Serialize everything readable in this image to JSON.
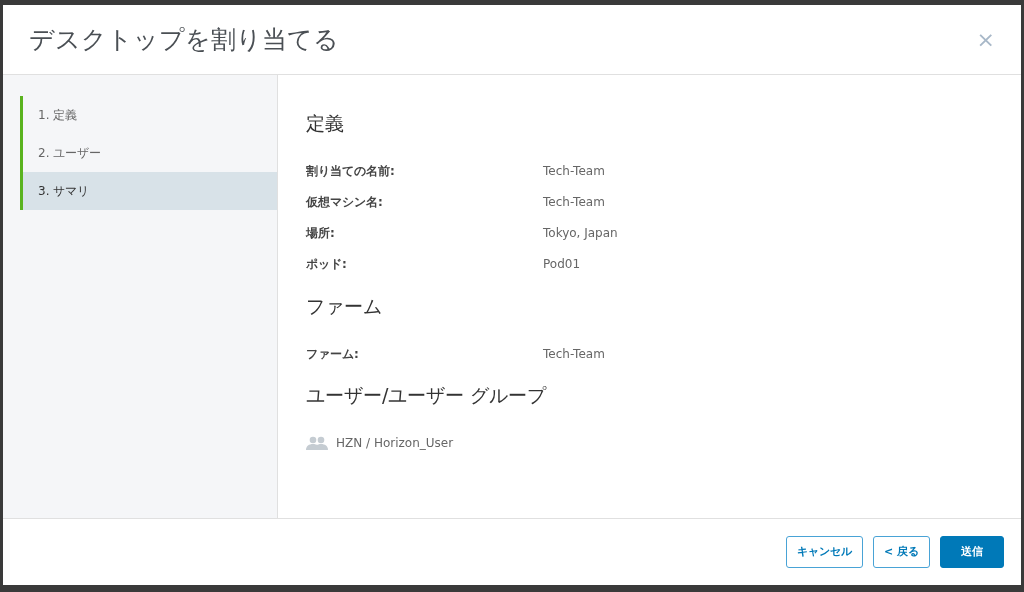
{
  "dialog": {
    "title": "デスクトップを割り当てる",
    "close": "×"
  },
  "steps": [
    {
      "label": "1. 定義",
      "selected": false
    },
    {
      "label": "2. ユーザー",
      "selected": false
    },
    {
      "label": "3. サマリ",
      "selected": true
    }
  ],
  "sections": [
    {
      "heading": "定義",
      "rows": [
        {
          "label": "割り当ての名前:",
          "value": "Tech-Team"
        },
        {
          "label": "仮想マシン名:",
          "value": "Tech-Team"
        },
        {
          "label": "場所:",
          "value": "Tokyo, Japan"
        },
        {
          "label": "ポッド:",
          "value": "Pod01"
        }
      ]
    },
    {
      "heading": "ファーム",
      "rows": [
        {
          "label": "ファーム:",
          "value": "Tech-Team"
        }
      ]
    },
    {
      "heading": "ユーザー/ユーザー グループ",
      "users": [
        "HZN / Horizon_User"
      ]
    }
  ],
  "buttons": [
    {
      "label": "キャンセル",
      "kind": "outline"
    },
    {
      "label": "< 戻る",
      "kind": "outline"
    },
    {
      "label": "送信",
      "kind": "primary"
    }
  ]
}
